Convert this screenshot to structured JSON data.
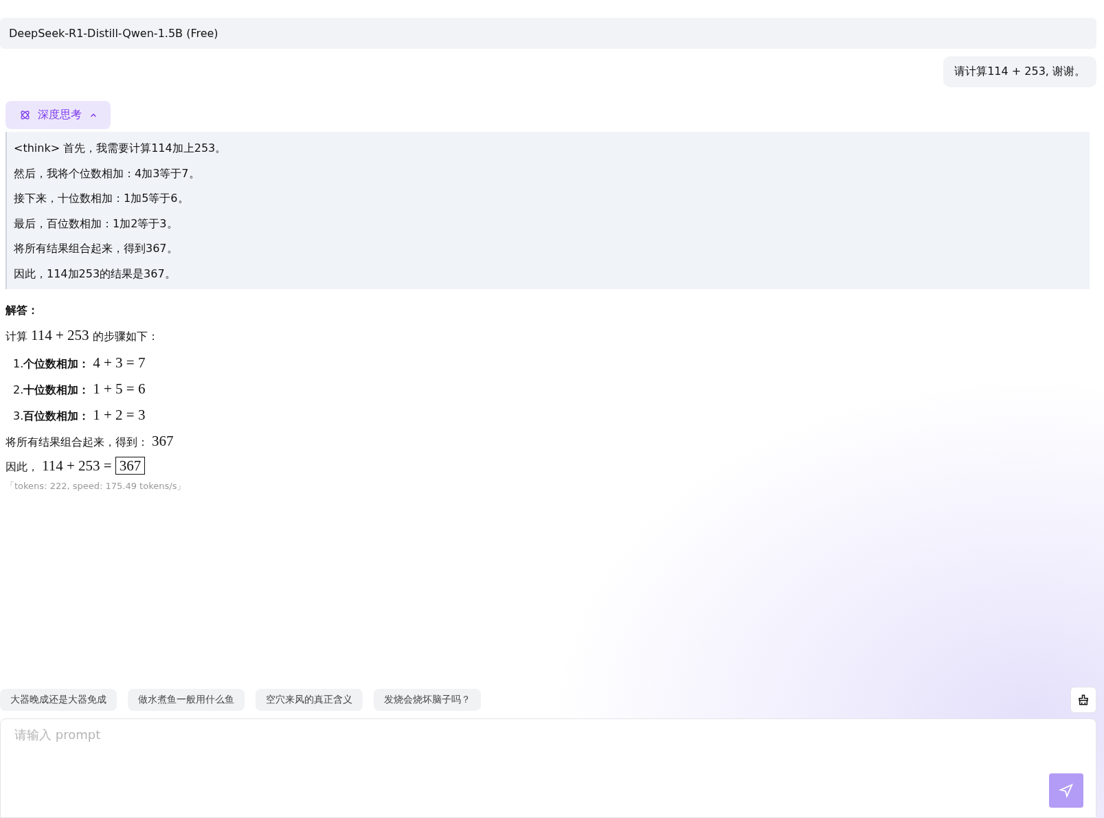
{
  "header": {
    "model": "DeepSeek-R1-Distill-Qwen-1.5B (Free)"
  },
  "user_message": "请计算114 + 253, 谢谢。",
  "thinking": {
    "label": "深度思考",
    "expanded": true,
    "lines": [
      "<think> 首先，我需要计算114加上253。",
      "然后，我将个位数相加：4加3等于7。",
      "接下来，十位数相加：1加5等于6。",
      "最后，百位数相加：1加2等于3。",
      "将所有结果组合起来，得到367。",
      "因此，114加253的结果是367。"
    ]
  },
  "answer": {
    "heading": "解答：",
    "intro": {
      "text": "计算",
      "math": "114 + 253",
      "after": "的步骤如下："
    },
    "steps": [
      {
        "number": "1.",
        "label": "个位数相加：",
        "math": "4 + 3 = 7"
      },
      {
        "number": "2.",
        "label": "十位数相加：",
        "math": "1 + 5 = 6"
      },
      {
        "number": "3.",
        "label": "百位数相加：",
        "math": "1 + 2 = 3"
      }
    ],
    "combined": {
      "text": "将所有结果组合起来，得到：",
      "math": "367"
    },
    "conclusion": {
      "text": "因此，",
      "math": "114 + 253 =",
      "boxed": "367"
    }
  },
  "stats": "「tokens: 222, speed: 175.49 tokens/s」",
  "suggestions": [
    "大器晚成还是大器免成",
    "做水煮鱼一般用什么鱼",
    "空穴来风的真正含义",
    "发烧会烧坏脑子吗？"
  ],
  "input": {
    "placeholder": "请输入 prompt"
  }
}
